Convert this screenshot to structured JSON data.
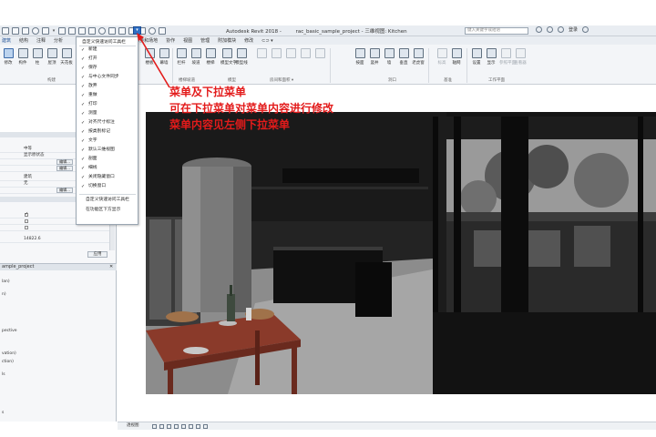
{
  "title_bar": {
    "app_title": "Autodesk Revit 2018 -",
    "project_title": "rac_basic_sample_project - 三维视图: Kitchen",
    "search_placeholder": "键入关键字或短语",
    "user_label": "登录"
  },
  "ribbon_tabs": [
    {
      "label": "建筑"
    },
    {
      "label": "结构"
    },
    {
      "label": "注释"
    },
    {
      "label": "分析"
    },
    {
      "label": "体量和场地"
    },
    {
      "label": "协作"
    },
    {
      "label": "视图"
    },
    {
      "label": "管理"
    },
    {
      "label": "附加模块"
    },
    {
      "label": "修改"
    },
    {
      "label": "⊂⊃ ▾"
    }
  ],
  "ribbon_tools": [
    {
      "label": "修改"
    },
    {
      "label": "构件"
    },
    {
      "label": "柱"
    },
    {
      "label": "屋顶"
    },
    {
      "label": "天花板"
    },
    {
      "label": "楼板"
    },
    {
      "label": "幕墙"
    },
    {
      "label": "栏杆"
    },
    {
      "label": "坡道"
    },
    {
      "label": "楼梯"
    },
    {
      "label": "模型文字"
    },
    {
      "label": "模型线"
    },
    {
      "label": "按面"
    },
    {
      "label": "竖井"
    },
    {
      "label": "墙"
    },
    {
      "label": "垂直"
    },
    {
      "label": "老虎窗"
    },
    {
      "label": "标高"
    },
    {
      "label": "轴网"
    },
    {
      "label": "设置"
    },
    {
      "label": "显示"
    },
    {
      "label": "参照平面"
    },
    {
      "label": "查看器"
    }
  ],
  "ribbon_panels": {
    "build": "构建",
    "model": "模型",
    "opening": "洞口",
    "datum": "基准",
    "work_plane": "工作平面",
    "room": "房间和面积 ▾",
    "stairs": "楼梯坡道"
  },
  "quick_access_menu": {
    "title": "自定义快速访问工具栏",
    "items": [
      {
        "label": "新建",
        "checked": true
      },
      {
        "label": "打开",
        "checked": true
      },
      {
        "label": "保存",
        "checked": true
      },
      {
        "label": "与中心文件同步",
        "checked": true
      },
      {
        "label": "放弃",
        "checked": true
      },
      {
        "label": "重做",
        "checked": true
      },
      {
        "label": "打印",
        "checked": true
      },
      {
        "label": "测量",
        "checked": true
      },
      {
        "label": "对齐尺寸标注",
        "checked": true
      },
      {
        "label": "按类别标记",
        "checked": true
      },
      {
        "label": "文字",
        "checked": true
      },
      {
        "label": "默认三维视图",
        "checked": true
      },
      {
        "label": "剖面",
        "checked": true
      },
      {
        "label": "细线",
        "checked": true
      },
      {
        "label": "关闭隐藏窗口",
        "checked": true
      },
      {
        "label": "切换窗口",
        "checked": true
      }
    ],
    "footer": [
      {
        "label": "自定义快速访问工具栏"
      },
      {
        "label": "在功能区下方显示"
      }
    ]
  },
  "properties": {
    "rows": [
      {
        "value": "中等"
      },
      {
        "value": "显示原状态"
      },
      {
        "value": "",
        "button": "编辑..."
      },
      {
        "value": "",
        "button": "编辑..."
      },
      {
        "value": "建筑"
      },
      {
        "value": "无"
      },
      {
        "value": "",
        "button": "编辑..."
      }
    ],
    "checkbox_rows": [
      {
        "checked": true
      },
      {
        "checked": false
      },
      {
        "checked": false
      }
    ],
    "number_value": "14822.6",
    "apply_label": "应用"
  },
  "project_browser": {
    "title": "ample_project",
    "items": [
      {
        "label": "lan)"
      },
      {
        "label": "n)"
      },
      {
        "label": "pective"
      },
      {
        "label": "vation)"
      },
      {
        "label": "ction)"
      },
      {
        "label": "ls"
      },
      {
        "label": "s"
      }
    ]
  },
  "view_control_bar": {
    "scale_label": "透视图"
  },
  "annotation": {
    "line1": "菜单及下拉菜单",
    "line2": "可在下拉菜单对菜单内容进行修改",
    "line3": "菜单内容见左侧下拉菜单",
    "color": "#e31b1b"
  }
}
